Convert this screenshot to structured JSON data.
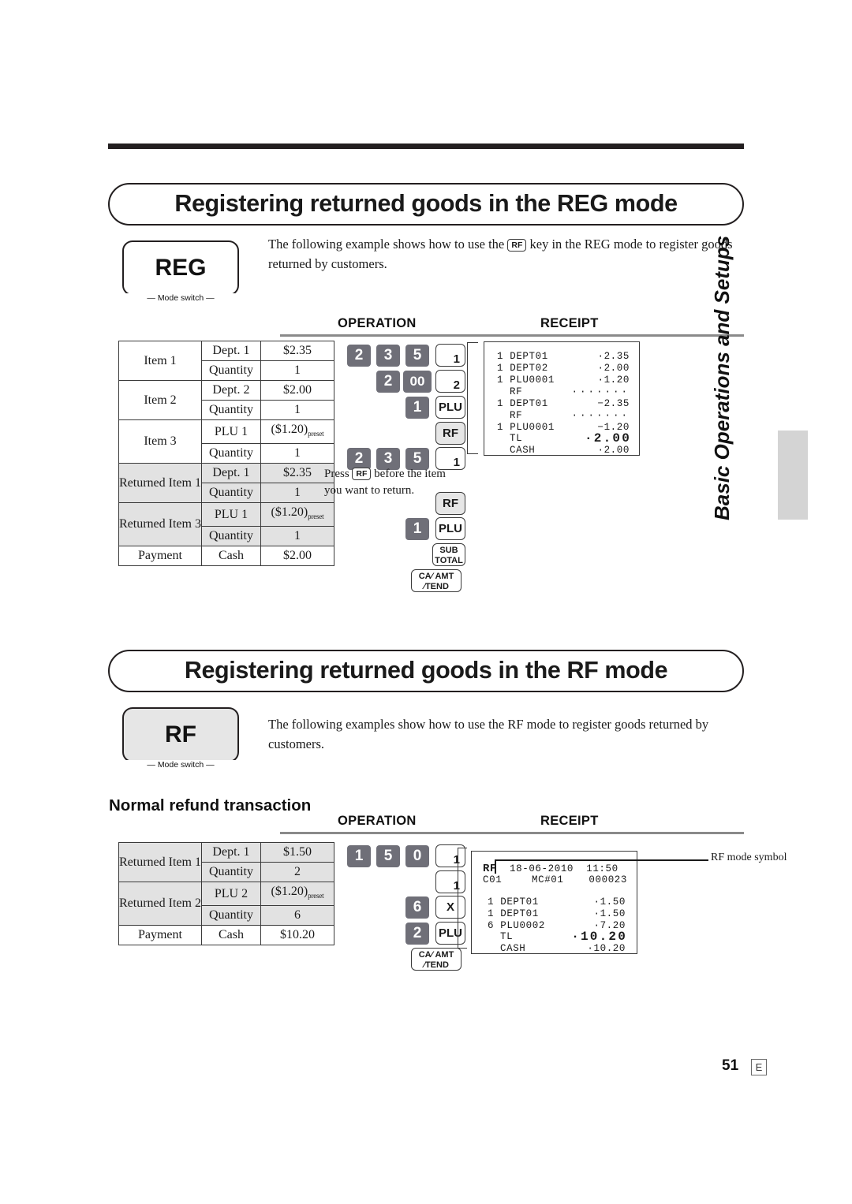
{
  "page": {
    "number": "51",
    "language_code": "E",
    "running_head": "Basic Operations and Setups"
  },
  "sections": [
    {
      "banner_title": "Registering returned goods in the REG mode",
      "mode_switch": {
        "label": "REG",
        "caption": "Mode switch"
      },
      "intro_prefix": "The following example shows how to use the",
      "intro_key": "RF",
      "intro_suffix": "key in the REG mode to register goods returned by customers.",
      "column_headers": {
        "operation": "OPERATION",
        "receipt": "RECEIPT"
      },
      "table": {
        "rows": [
          {
            "shaded": false,
            "label": "Item 1",
            "label_rowspan": 2,
            "field": "Dept. 1",
            "value": "$2.35"
          },
          {
            "shaded": false,
            "label": null,
            "field": "Quantity",
            "value": "1"
          },
          {
            "shaded": false,
            "label": "Item 2",
            "label_rowspan": 2,
            "field": "Dept. 2",
            "value": "$2.00"
          },
          {
            "shaded": false,
            "label": null,
            "field": "Quantity",
            "value": "1"
          },
          {
            "shaded": false,
            "label": "Item 3",
            "label_rowspan": 2,
            "field": "PLU 1",
            "value": "($1.20)",
            "value_sub": "preset"
          },
          {
            "shaded": false,
            "label": null,
            "field": "Quantity",
            "value": "1"
          },
          {
            "shaded": true,
            "label": "Returned Item 1",
            "label_rowspan": 2,
            "field": "Dept. 1",
            "value": "$2.35"
          },
          {
            "shaded": true,
            "label": null,
            "field": "Quantity",
            "value": "1"
          },
          {
            "shaded": true,
            "label": "Returned Item 3",
            "label_rowspan": 2,
            "field": "PLU 1",
            "value": "($1.20)",
            "value_sub": "preset"
          },
          {
            "shaded": true,
            "label": null,
            "field": "Quantity",
            "value": "1"
          },
          {
            "shaded": false,
            "label": "Payment",
            "label_rowspan": 1,
            "field": "Cash",
            "value": "$2.00"
          }
        ]
      },
      "operation_keys": [
        {
          "keys": [
            "2",
            "3",
            "5"
          ],
          "action": {
            "type": "dept",
            "label": "1"
          }
        },
        {
          "keys": [
            "2",
            "00"
          ],
          "action": {
            "type": "dept",
            "label": "2"
          }
        },
        {
          "keys": [
            "1"
          ],
          "action": {
            "type": "fn",
            "label": "PLU"
          }
        },
        {
          "keys": [],
          "action": {
            "type": "fn-gray",
            "label": "RF"
          }
        },
        {
          "keys": [
            "2",
            "3",
            "5"
          ],
          "action": {
            "type": "dept",
            "label": "1"
          }
        },
        {
          "keys": [],
          "action": {
            "type": "fn-gray",
            "label": "RF"
          }
        },
        {
          "keys": [
            "1"
          ],
          "action": {
            "type": "fn",
            "label": "PLU"
          }
        },
        {
          "keys": [],
          "action": {
            "type": "fn-2line",
            "label": "SUB\nTOTAL"
          }
        },
        {
          "keys": [],
          "action": {
            "type": "fn-wide",
            "label": "CA/ AMT\n/TEND"
          }
        }
      ],
      "key_note": {
        "prefix": "Press",
        "key": "RF",
        "suffix": "before the item you want to return."
      },
      "receipt_lines": [
        {
          "qty": "1",
          "name": "DEPT01",
          "amount": "·2.35"
        },
        {
          "qty": "1",
          "name": "DEPT02",
          "amount": "·2.00"
        },
        {
          "qty": "1",
          "name": "PLU0001",
          "amount": "·1.20"
        },
        {
          "qty": "",
          "name": "RF",
          "amount": "·······"
        },
        {
          "qty": "1",
          "name": "DEPT01",
          "amount": "−2.35"
        },
        {
          "qty": "",
          "name": "RF",
          "amount": "·······"
        },
        {
          "qty": "1",
          "name": "PLU0001",
          "amount": "−1.20"
        },
        {
          "qty": "",
          "name": "TL",
          "amount": "·2.00",
          "big": true
        },
        {
          "qty": "",
          "name": "CASH",
          "amount": "·2.00"
        }
      ]
    },
    {
      "banner_title": "Registering returned goods in the RF mode",
      "mode_switch": {
        "label": "RF",
        "caption": "Mode switch"
      },
      "intro_text": "The following examples show how to use the RF mode to register goods returned by customers.",
      "sub_heading": "Normal refund transaction",
      "column_headers": {
        "operation": "OPERATION",
        "receipt": "RECEIPT"
      },
      "table": {
        "rows": [
          {
            "shaded": true,
            "label": "Returned Item 1",
            "label_rowspan": 2,
            "field": "Dept. 1",
            "value": "$1.50"
          },
          {
            "shaded": true,
            "label": null,
            "field": "Quantity",
            "value": "2"
          },
          {
            "shaded": true,
            "label": "Returned Item 2",
            "label_rowspan": 2,
            "field": "PLU 2",
            "value": "($1.20)",
            "value_sub": "preset"
          },
          {
            "shaded": true,
            "label": null,
            "field": "Quantity",
            "value": "6"
          },
          {
            "shaded": false,
            "label": "Payment",
            "label_rowspan": 1,
            "field": "Cash",
            "value": "$10.20"
          }
        ]
      },
      "operation_keys": [
        {
          "keys": [
            "1",
            "5",
            "0"
          ],
          "action": {
            "type": "dept",
            "label": "1"
          }
        },
        {
          "keys": [],
          "action": {
            "type": "dept",
            "label": "1"
          }
        },
        {
          "keys": [
            "6"
          ],
          "action": {
            "type": "fn",
            "label": "X"
          }
        },
        {
          "keys": [
            "2"
          ],
          "action": {
            "type": "fn",
            "label": "PLU"
          }
        },
        {
          "keys": [],
          "action": {
            "type": "fn-wide",
            "label": "CA/ AMT\n/TEND"
          }
        }
      ],
      "receipt_header": {
        "mode": "RF",
        "date": "18-06-2010",
        "time": "11:50",
        "clerk": "C01",
        "machine": "MC#01",
        "consecutive": "000023"
      },
      "receipt_lines": [
        {
          "qty": "1",
          "name": "DEPT01",
          "amount": "·1.50"
        },
        {
          "qty": "1",
          "name": "DEPT01",
          "amount": "·1.50"
        },
        {
          "qty": "6",
          "name": "PLU0002",
          "amount": "·7.20"
        },
        {
          "qty": "",
          "name": "TL",
          "amount": "·10.20",
          "big": true
        },
        {
          "qty": "",
          "name": "CASH",
          "amount": "·10.20"
        }
      ],
      "callout": "RF mode symbol"
    }
  ]
}
